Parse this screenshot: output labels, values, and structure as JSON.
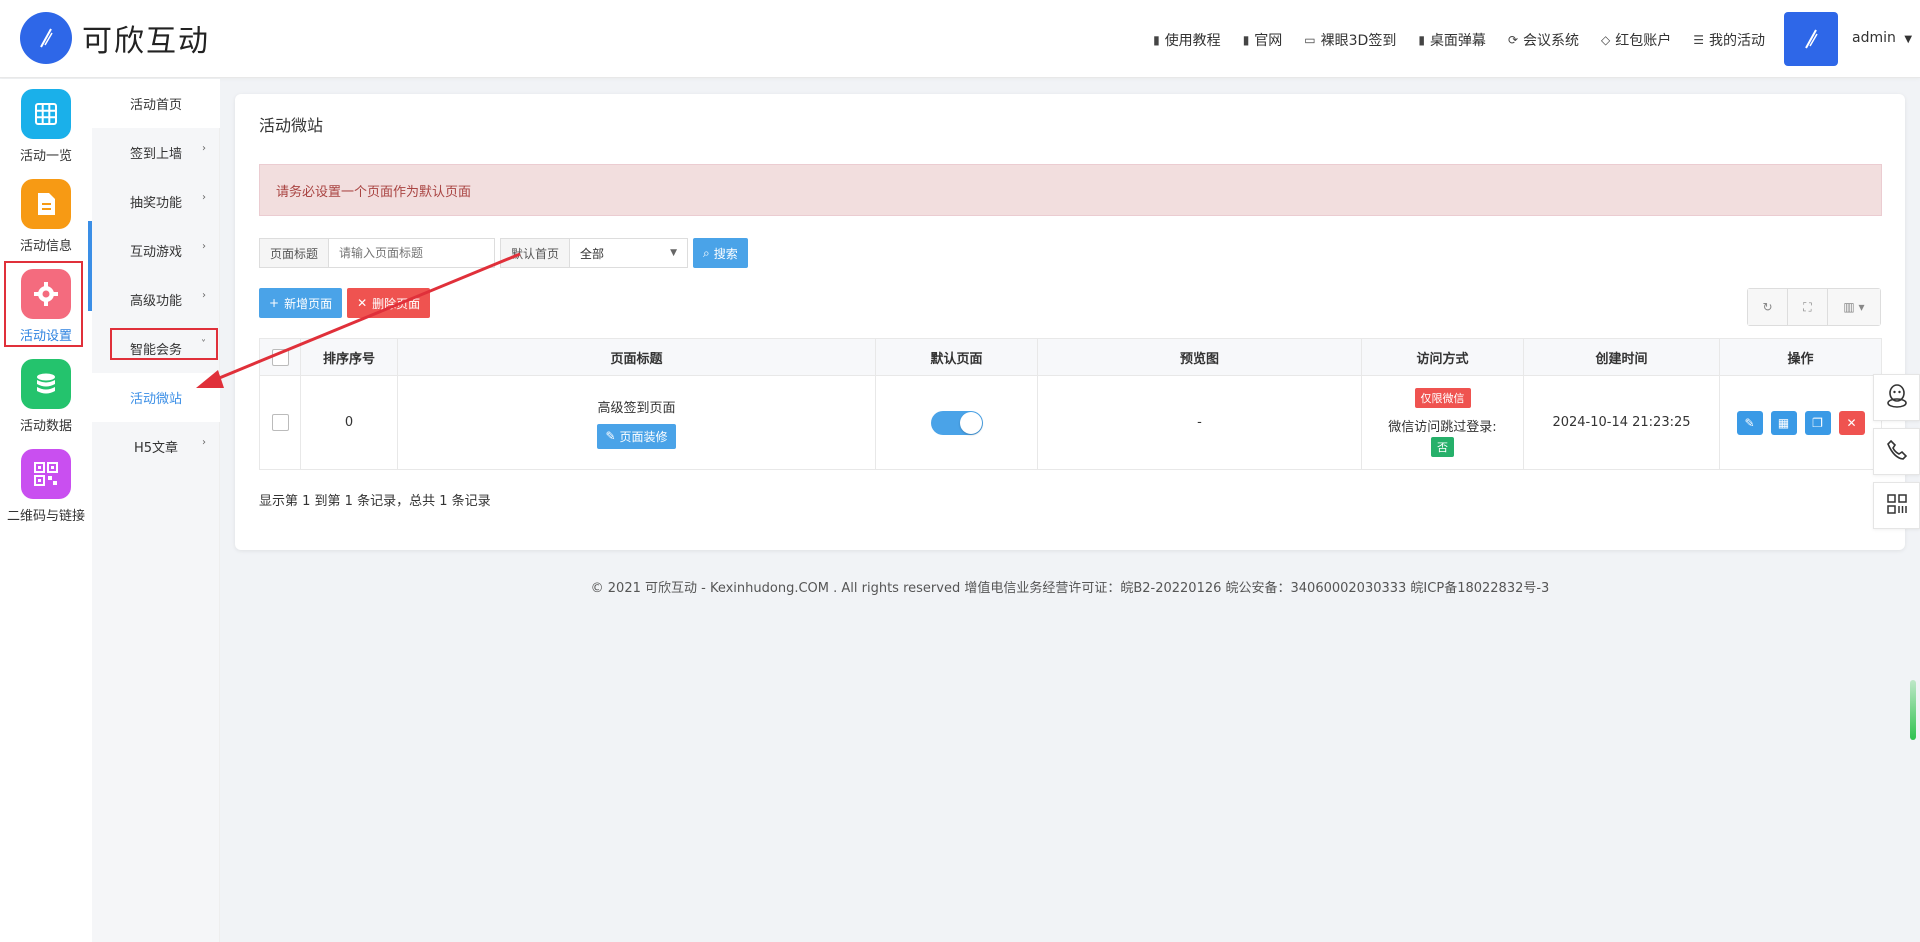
{
  "brand": {
    "name": "可欣互动"
  },
  "topnav": [
    {
      "icon": "doc-icon",
      "label": "使用教程"
    },
    {
      "icon": "doc-icon",
      "label": "官网"
    },
    {
      "icon": "monitor-icon",
      "label": "裸眼3D签到"
    },
    {
      "icon": "doc-icon",
      "label": "桌面弹幕"
    },
    {
      "icon": "meeting-icon",
      "label": "会议系统"
    },
    {
      "icon": "diamond-icon",
      "label": "红包账户"
    },
    {
      "icon": "list-icon",
      "label": "我的活动"
    }
  ],
  "user": {
    "name": "admin"
  },
  "iconbar": [
    {
      "label": "活动一览",
      "icon": "grid-icon",
      "color": "#1ab0ea"
    },
    {
      "label": "活动信息",
      "icon": "document-icon",
      "color": "#f79a14"
    },
    {
      "label": "活动设置",
      "icon": "gear-icon",
      "color": "#f46b7e"
    },
    {
      "label": "活动数据",
      "icon": "database-icon",
      "color": "#24c36d"
    },
    {
      "label": "二维码与链接",
      "icon": "qrcode-icon",
      "color": "#c94ff0"
    }
  ],
  "submenu": [
    {
      "label": "活动首页",
      "caret": ""
    },
    {
      "label": "签到上墙",
      "caret": "›"
    },
    {
      "label": "抽奖功能",
      "caret": "›"
    },
    {
      "label": "互动游戏",
      "caret": "›"
    },
    {
      "label": "高级功能",
      "caret": "›"
    },
    {
      "label": "智能会务",
      "caret": "˅"
    },
    {
      "label": "活动微站",
      "caret": ""
    },
    {
      "label": "H5文章",
      "caret": "›"
    }
  ],
  "card": {
    "title": "活动微站",
    "alert": "请务必设置一个页面作为默认页面"
  },
  "search": {
    "title_label": "页面标题",
    "title_placeholder": "请输入页面标题",
    "default_label": "默认首页",
    "default_value": "全部",
    "button": "搜索"
  },
  "actions": {
    "add": "新增页面",
    "delete": "删除页面"
  },
  "table": {
    "headers": [
      "排序序号",
      "页面标题",
      "默认页面",
      "预览图",
      "访问方式",
      "创建时间",
      "操作"
    ],
    "rows": [
      {
        "order": "0",
        "title": "高级签到页面",
        "decorate": "页面装修",
        "default": true,
        "preview": "-",
        "access_badge": "仅限微信",
        "access_text": "微信访问跳过登录:",
        "access_value": "否",
        "created": "2024-10-14 21:23:25"
      }
    ]
  },
  "pager": "显示第 1 到第 1 条记录，总共 1 条记录",
  "footer": "© 2021 可欣互动 - Kexinhudong.COM . All rights reserved 增值电信业务经营许可证：皖B2-20220126 皖公安备：34060002030333 皖ICP备18022832号-3",
  "colors": {
    "accent": "#2e67e8",
    "primary_button": "#4aa3e8",
    "danger": "#ef5350",
    "annotation": "#e0303a"
  }
}
